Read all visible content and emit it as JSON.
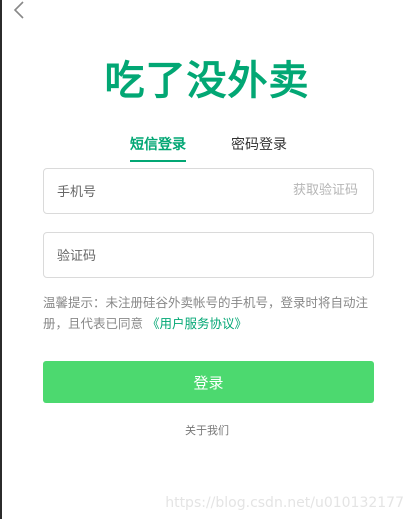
{
  "app": {
    "title": "吃了没外卖"
  },
  "tabs": [
    {
      "label": "短信登录",
      "active": true
    },
    {
      "label": "密码登录",
      "active": false
    }
  ],
  "form": {
    "phone_placeholder": "手机号",
    "get_code_label": "获取验证码",
    "code_placeholder": "验证码"
  },
  "tip": {
    "text": "温馨提示：未注册硅谷外卖帐号的手机号，登录时将自动注册，且代表已同意 ",
    "agreement_link": "《用户服务协议》"
  },
  "login_button": "登录",
  "about_link": "关于我们",
  "watermark": "https://blog.csdn.net/u010132177",
  "colors": {
    "brand": "#02a774",
    "button": "#4cd96f",
    "tab_underline": "#02a774"
  },
  "icons": {
    "back": "chevron-left-icon"
  }
}
